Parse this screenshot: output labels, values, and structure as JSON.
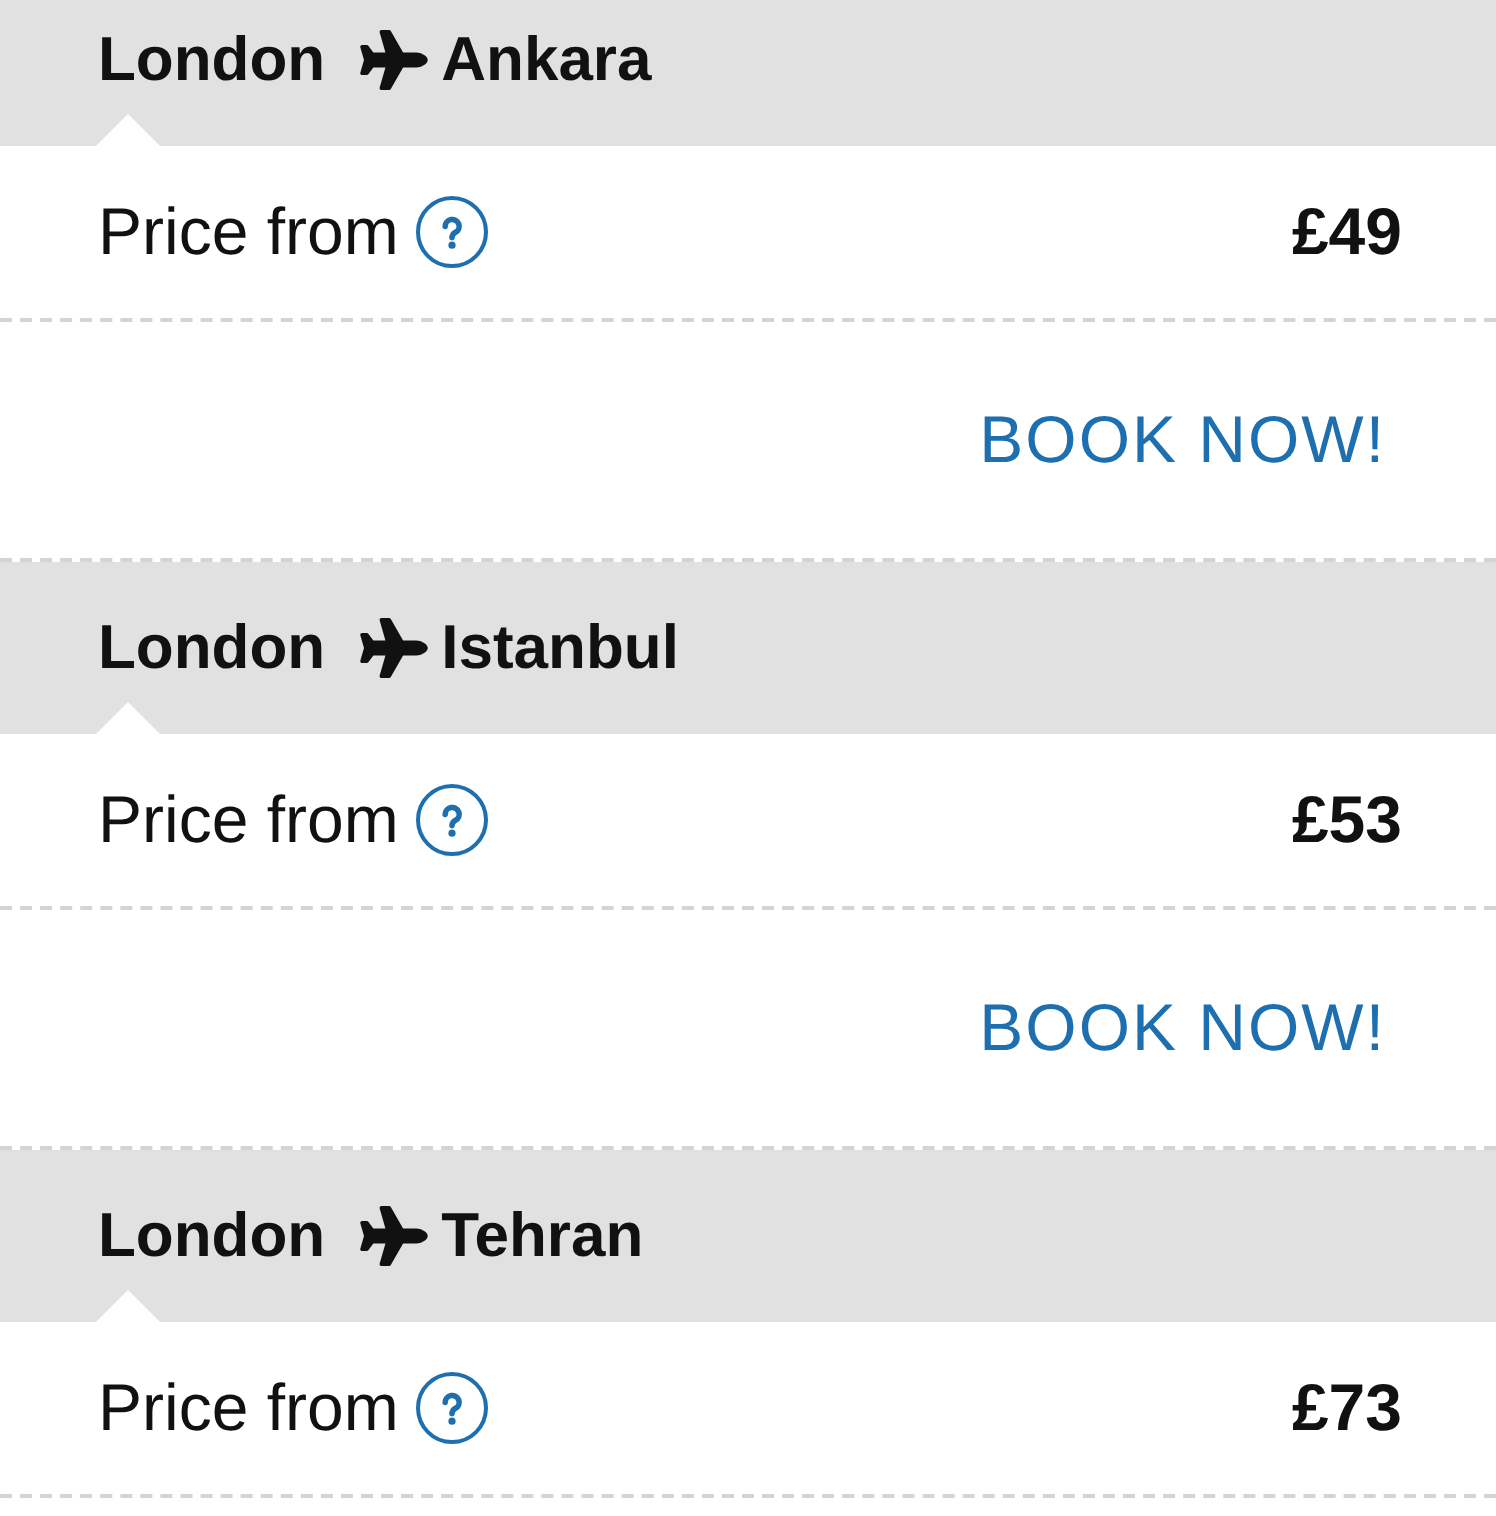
{
  "routes": [
    {
      "origin": "London",
      "destination": "Ankara",
      "price_label": "Price from",
      "price": "£49",
      "book_label": "BOOK NOW!"
    },
    {
      "origin": "London",
      "destination": "Istanbul",
      "price_label": "Price from",
      "price": "£53",
      "book_label": "BOOK NOW!"
    },
    {
      "origin": "London",
      "destination": "Tehran",
      "price_label": "Price from",
      "price": "£73"
    }
  ]
}
